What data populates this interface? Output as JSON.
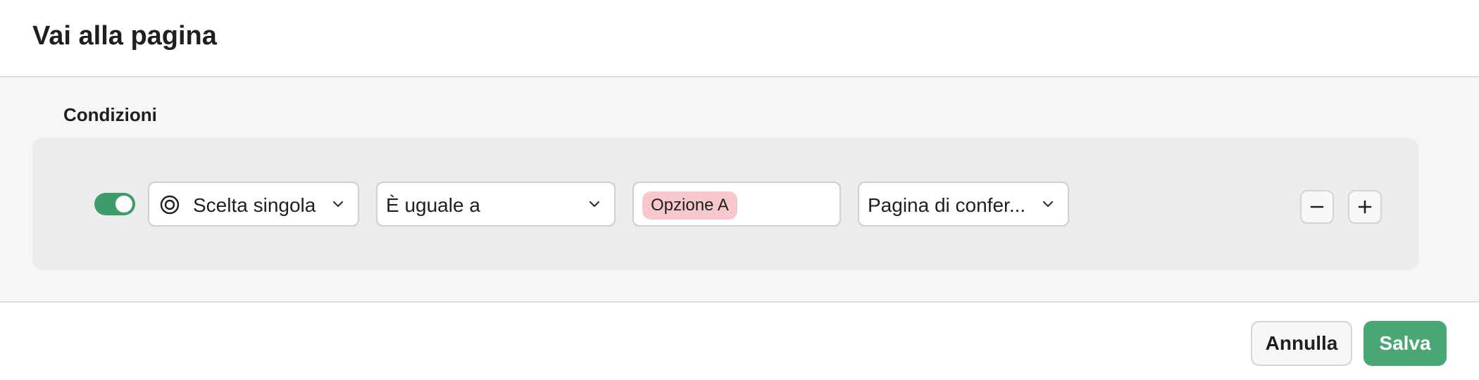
{
  "dialog": {
    "title": "Vai alla pagina"
  },
  "conditions": {
    "section_label": "Condizioni",
    "rule": {
      "enabled": true,
      "field_type": "Scelta singola",
      "operator": "È uguale a",
      "value_chip": "Opzione A",
      "target_page": "Pagina di confer..."
    }
  },
  "footer": {
    "cancel_label": "Annulla",
    "save_label": "Salva"
  },
  "colors": {
    "accent": "#4aa672",
    "toggle_on": "#3e9b6a",
    "chip": "#f7c7ce"
  },
  "icons": {
    "field_type": "radio-target-icon",
    "dropdown": "chevron-down-icon",
    "remove": "minus-icon",
    "add": "plus-icon"
  }
}
